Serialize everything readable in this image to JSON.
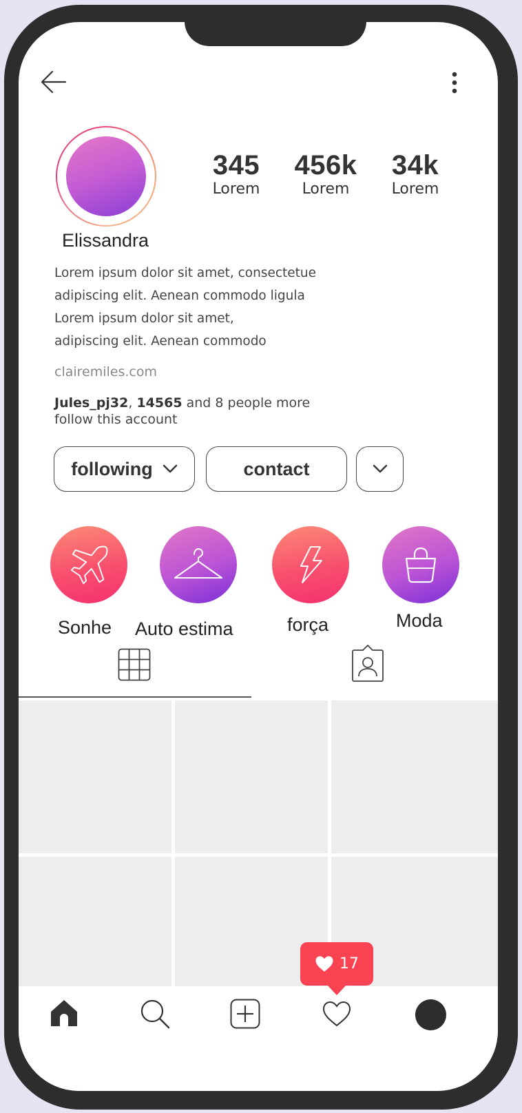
{
  "profile": {
    "name": "Elissandra",
    "stats": [
      {
        "value": "345",
        "label": "Lorem"
      },
      {
        "value": "456k",
        "label": "Lorem"
      },
      {
        "value": "34k",
        "label": "Lorem"
      }
    ],
    "bio": [
      "Lorem ipsum dolor sit amet, consectetue",
      "adipiscing elit. Aenean commodo ligula",
      "Lorem ipsum dolor sit amet,",
      "adipiscing elit. Aenean commodo"
    ],
    "website": "clairemiles.com",
    "followed_by": {
      "user1": "Jules_pj32",
      "separator": ",",
      "user2": "14565",
      "rest": "and 8 people more",
      "line2": "follow this account"
    }
  },
  "actions": {
    "following_label": "following",
    "contact_label": "contact"
  },
  "highlights": [
    {
      "label": "Sonhe",
      "icon": "airplane-icon"
    },
    {
      "label": "Auto estima",
      "icon": "hanger-icon"
    },
    {
      "label": "força",
      "icon": "lightning-icon"
    },
    {
      "label": "Moda",
      "icon": "shopping-bag-icon"
    }
  ],
  "tabs": [
    {
      "icon": "grid-icon",
      "active": true
    },
    {
      "icon": "tagged-user-icon",
      "active": false
    }
  ],
  "notification": {
    "count": "17",
    "icon": "heart-icon",
    "color": "#fa4352"
  },
  "navbar": [
    "home-icon",
    "search-icon",
    "add-post-icon",
    "heart-icon",
    "profile-icon"
  ],
  "colors": {
    "accent_red": "#f8506e",
    "accent_purple": "#bb53d6",
    "frame": "#2d2d2d"
  }
}
